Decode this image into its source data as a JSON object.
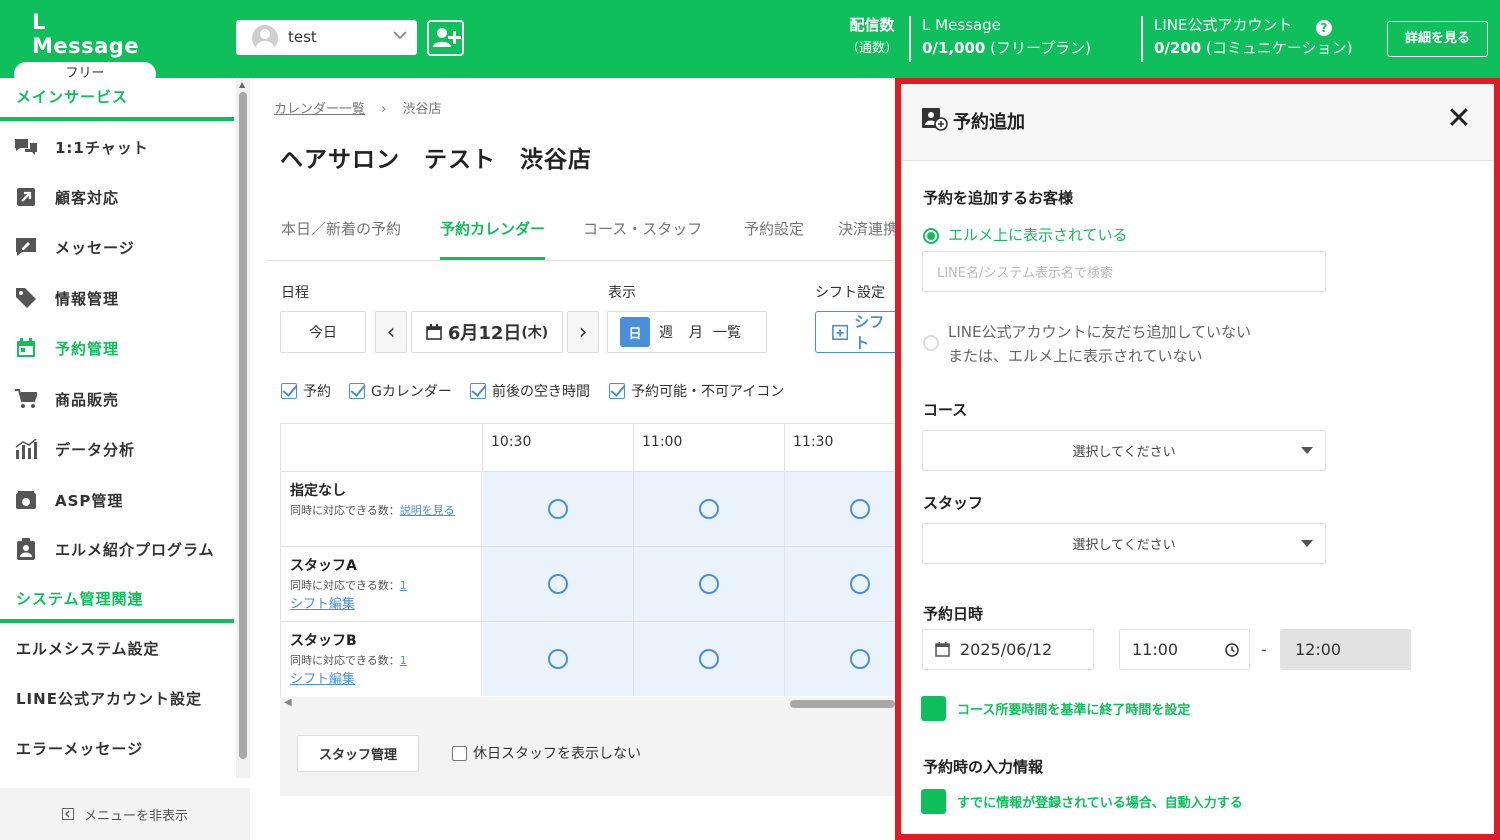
{
  "header": {
    "brand": "L Message",
    "plan_badge": "フリー",
    "account_name": "test",
    "delivery_label": "配信数",
    "delivery_sub": "（通数）",
    "lmessage_label": "L Message",
    "lmessage_count": "0/1,000",
    "lmessage_plan": "(フリープラン)",
    "line_label": "LINE公式アカウント",
    "line_count": "0/200",
    "line_plan": "(コミュニケーション)",
    "help": "?",
    "detail_button": "詳細を見る",
    "colors": {
      "brand_green": "#0fbf5b",
      "panel_border": "#e01b24",
      "accent_blue": "#4a90d9"
    }
  },
  "sidebar": {
    "section_main": "メインサービス",
    "items": [
      {
        "label": "1:1チャット",
        "icon": "chat-bubbles-icon"
      },
      {
        "label": "顧客対応",
        "icon": "arrow-up-right-icon"
      },
      {
        "label": "メッセージ",
        "icon": "message-edit-icon"
      },
      {
        "label": "情報管理",
        "icon": "tag-icon"
      },
      {
        "label": "予約管理",
        "icon": "calendar-icon",
        "active": true
      },
      {
        "label": "商品販売",
        "icon": "cart-icon"
      },
      {
        "label": "データ分析",
        "icon": "bar-chart-icon"
      },
      {
        "label": "ASP管理",
        "icon": "asp-box-icon"
      },
      {
        "label": "エルメ紹介プログラム",
        "icon": "clipboard-person-icon"
      }
    ],
    "section_system": "システム管理関連",
    "system_items": [
      "エルメシステム設定",
      "LINE公式アカウント設定",
      "エラーメッセージ"
    ],
    "hide_menu": "メニューを非表示"
  },
  "main": {
    "breadcrumb_link": "カレンダー一覧",
    "breadcrumb_sep": "›",
    "breadcrumb_current": "渋谷店",
    "title": "ヘアサロン　テスト　渋谷店",
    "tabs": [
      "本日／新着の予約",
      "予約カレンダー",
      "コース・スタッフ",
      "予約設定",
      "決済連携"
    ],
    "active_tab": 1,
    "schedule_label": "日程",
    "today_button": "今日",
    "prev": "‹",
    "next": "›",
    "date_main": "6月12日",
    "date_weekday": "(木)",
    "display_label": "表示",
    "view_day": "日",
    "view_week": "週",
    "view_month": "月",
    "view_list": "一覧",
    "shift_label": "シフト設定",
    "shift_button": "シフト",
    "checks": [
      "予約",
      "Gカレンダー",
      "前後の空き時間",
      "予約可能・不可アイコン"
    ],
    "grid": {
      "times": [
        "10:30",
        "11:00",
        "11:30"
      ],
      "rows": [
        {
          "name": "指定なし",
          "capacity_label": "同時に対応できる数：",
          "capacity_value": "説明を見る",
          "edit": ""
        },
        {
          "name": "スタッフA",
          "capacity_label": "同時に対応できる数：",
          "capacity_value": "1",
          "edit": "シフト編集"
        },
        {
          "name": "スタッフB",
          "capacity_label": "同時に対応できる数：",
          "capacity_value": "1",
          "edit": "シフト編集"
        }
      ]
    },
    "staff_mgmt_button": "スタッフ管理",
    "hide_holiday": "休日スタッフを表示しない"
  },
  "panel": {
    "title": "予約追加",
    "close": "✕",
    "customer_label": "予約を追加するお客様",
    "option_shown": "エルメ上に表示されている",
    "search_placeholder": "LINE名/システム表示名で検索",
    "option_not_shown_1": "LINE公式アカウントに友だち追加していない",
    "option_not_shown_2": "または、エルメ上に表示されていない",
    "course_label": "コース",
    "course_placeholder": "選択してください",
    "staff_label": "スタッフ",
    "staff_placeholder": "選択してください",
    "datetime_label": "予約日時",
    "date_value": "2025/06/12",
    "start_time": "11:00",
    "range_sep": "-",
    "end_time": "12:00",
    "auto_end_toggle": "コース所要時間を基準に終了時間を設定",
    "input_info_label": "予約時の入力情報",
    "autofill_toggle": "すでに情報が登録されている場合、自動入力する"
  }
}
